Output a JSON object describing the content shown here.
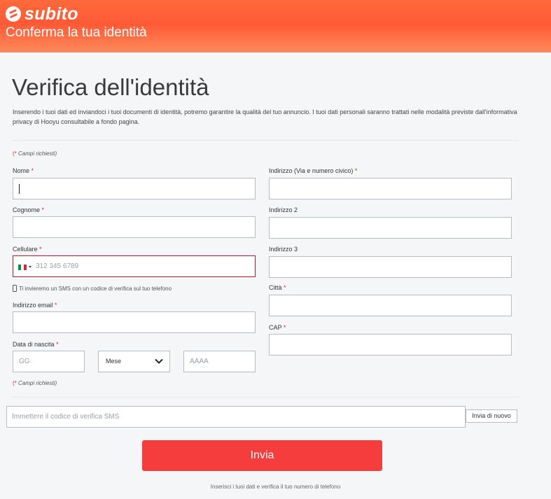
{
  "header": {
    "logo_text": "subito",
    "title": "Conferma la tua identità"
  },
  "page": {
    "title": "Verifica dell'identità",
    "intro": "Inserendo i tuoi dati ed inviandoci i tuoi documenti di identità, potremo garantire la qualità del tuo annuncio. I tuoi dati personali saranno trattati nelle modalità previste dall'informativa privacy di Hooyu consultabile a fondo pagina.",
    "required_note_star": "(*",
    "required_note_text": " Campi richiesti)"
  },
  "form": {
    "nome": {
      "label": "Nome",
      "value": ""
    },
    "cognome": {
      "label": "Cognome",
      "value": ""
    },
    "cellulare": {
      "label": "Cellulare",
      "placeholder": "312 345 6789",
      "country": "IT"
    },
    "sms_hint": "Ti invieremo un SMS con un codice di verifica sul tuo telefono",
    "email": {
      "label": "Indirizzo email",
      "value": ""
    },
    "dob": {
      "label": "Data di nascita",
      "day_placeholder": "GG",
      "month_value": "Mese",
      "year_placeholder": "AAAA"
    },
    "indirizzo": {
      "label": "Indirizzo (Via e numero civico)",
      "value": ""
    },
    "indirizzo2": {
      "label": "Indirizzo 2",
      "value": ""
    },
    "indirizzo3": {
      "label": "Indirizzo 3",
      "value": ""
    },
    "citta": {
      "label": "Città",
      "value": ""
    },
    "cap": {
      "label": "CAP",
      "value": ""
    },
    "required_star": "*"
  },
  "verification": {
    "code_placeholder": "Immettere il codice di verifica SMS",
    "resend_label": "Invia di nuovo",
    "submit_label": "Invia",
    "footer_note": "Inserisci i tuoi dati e verifica il tuo numero di telefono"
  },
  "colors": {
    "brand": "#ff5a36",
    "submit": "#f53d3d",
    "required": "#d9262b",
    "error_border": "#c8162a"
  }
}
